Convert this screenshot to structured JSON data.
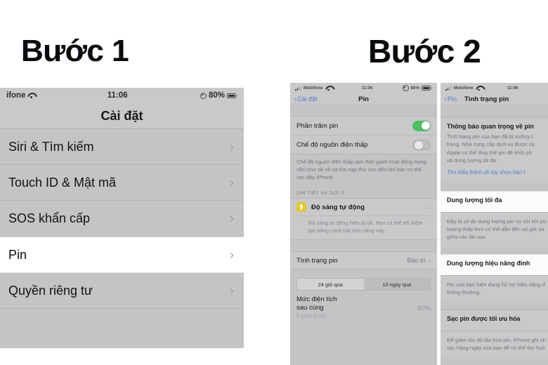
{
  "steps": {
    "step1": "Bước 1",
    "step2": "Bước 2"
  },
  "colors": {
    "accent_blue": "#4d84c8",
    "toggle_on_green": "#4cbf61",
    "bulb_yellow": "#e4c82b",
    "panel_gray": "#c4c3c6",
    "row_gray": "#c9c8cb",
    "selected_white": "#ffffff"
  },
  "status_bar": {
    "carrier": "Mobifone",
    "carrier_short": "ifone",
    "time": "11:06",
    "battery_percent": "80%"
  },
  "left_phone": {
    "nav_title": "Cài đặt",
    "rows": [
      {
        "label": "Siri & Tìm kiếm",
        "selected": false
      },
      {
        "label": "Touch ID & Mật mã",
        "selected": false
      },
      {
        "label": "SOS khẩn cấp",
        "selected": false
      },
      {
        "label": "Pin",
        "selected": true
      },
      {
        "label": "Quyền riêng tư",
        "selected": false
      }
    ],
    "chevron": "›"
  },
  "mid_phone": {
    "back_label": "Cài đặt",
    "nav_title": "Pin",
    "toggles": [
      {
        "label": "Phần trăm pin",
        "state": "on"
      },
      {
        "label": "Chế độ nguồn điện thấp",
        "state": "off"
      }
    ],
    "low_power_desc": "Chế độ nguồn điện thấp tạm thời giảm hoạt động trong nền như tải về và tìm nạp thư cho đến khi bạn có thể sạc đầy iPhone.",
    "section_header": "CHI TIẾT VÀ GỢI Ý",
    "auto_brightness": {
      "icon": "lightbulb-icon",
      "label": "Độ sáng tự động",
      "desc": "Độ sáng tự động hiện bị tắt. Bạn có thể tiết kiệm pin bằng cách bật tính năng này."
    },
    "battery_health_row": {
      "label": "Tình trạng pin",
      "value": "Bảo trì"
    },
    "segments": [
      {
        "label": "24 giờ qua",
        "active": true
      },
      {
        "label": "10 ngày qua",
        "active": false
      }
    ],
    "last_level": {
      "line1": "Mức điện tích",
      "line2": "sau cùng",
      "percent": "80%",
      "ago": "6 phút trước"
    }
  },
  "right_phone": {
    "back_label": "Pin",
    "nav_title": "Tình trạng pin",
    "cards": [
      {
        "title": "Thông báo quan trọng về pin",
        "body": "Tình trạng pin của bạn đã bị xuống c\ntrọng. Nhà cung cấp dịch vụ được ủy\nApple có thể thay thế pin để khôi ph\nvà dung lượng tối đa.",
        "link": "Tìm hiểu thêm về tùy chọn bảo t",
        "white": false
      },
      {
        "title": "Dung lượng tối đa",
        "body": "Đây là số đo dung lượng pin so với khi pin\nlượng thấp hơn có thể dẫn đến số giờ sử\ngiữa các lần sạc.",
        "link": "",
        "white": true
      },
      {
        "title": "Dung lượng hiệu năng đỉnh",
        "body": "Pin của bạn hiện đang hỗ trợ hiệu năng đ\nthông thường.",
        "link": "",
        "white": true
      },
      {
        "title": "Sạc pin được tối ưu hóa",
        "body": "Để giảm tốc độ lão hóa pin, iPhone ghi nh\nsạc hàng ngày của bạn để có thể đợi hoà",
        "link": "",
        "white": false
      }
    ]
  }
}
